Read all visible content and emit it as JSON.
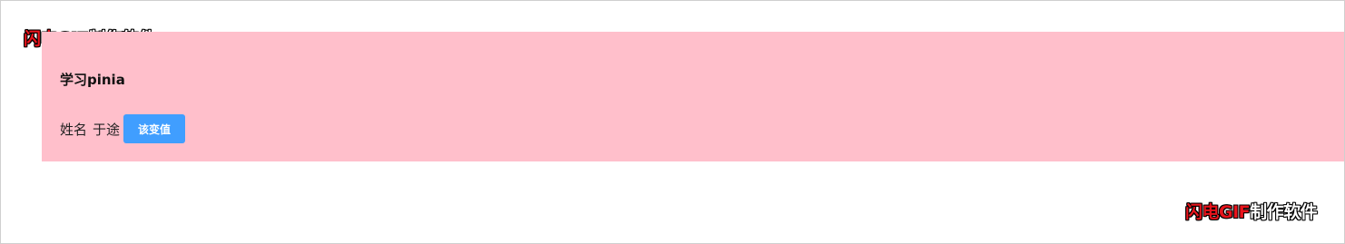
{
  "page": {
    "title": "学习pinia"
  },
  "form": {
    "name_label": "姓名",
    "name_value": "于途",
    "change_button_label": "该变值"
  },
  "watermark": {
    "brand": "闪电GIF",
    "suffix": "制作软件"
  },
  "colors": {
    "panel_background": "#ffbfcb",
    "button_background": "#409eff",
    "watermark_brand": "#e8141c"
  }
}
